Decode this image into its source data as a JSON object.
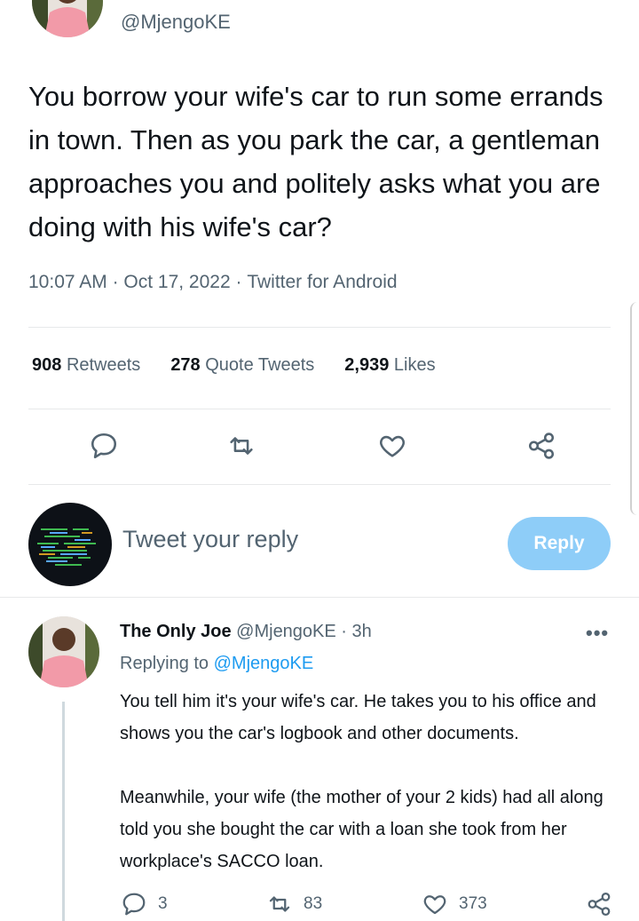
{
  "tweet": {
    "handle": "@MjengoKE",
    "text": "You borrow your wife's car to run some errands in town. Then as you park the car, a gentleman approaches you and politely asks what you are doing with his wife's car?",
    "time": "10:07 AM",
    "date": "Oct 17, 2022",
    "source": "Twitter for Android",
    "stats": {
      "retweets_count": "908",
      "retweets_label": "Retweets",
      "quotes_count": "278",
      "quotes_label": "Quote Tweets",
      "likes_count": "2,939",
      "likes_label": "Likes"
    }
  },
  "composer": {
    "placeholder": "Tweet your reply",
    "reply_label": "Reply"
  },
  "reply": {
    "name": "The Only Joe",
    "handle": "@MjengoKE",
    "age": "3h",
    "replying_prefix": "Replying to",
    "replying_to": "@MjengoKE",
    "paragraphs": [
      "You tell him it's your wife's car. He takes you to his office and shows you the car's logbook and other documents.",
      "Meanwhile, your wife (the mother of your 2 kids) had all along told you she bought the car with a loan she took from her workplace's SACCO loan."
    ],
    "reply_count": "3",
    "retweet_count": "83",
    "like_count": "373"
  },
  "colors": {
    "accent": "#1d9bf0",
    "reply_button_disabled": "#8ecdf8",
    "muted_text": "#536471"
  },
  "icons": [
    "comment-icon",
    "retweet-icon",
    "heart-icon",
    "share-icon",
    "more-icon"
  ]
}
